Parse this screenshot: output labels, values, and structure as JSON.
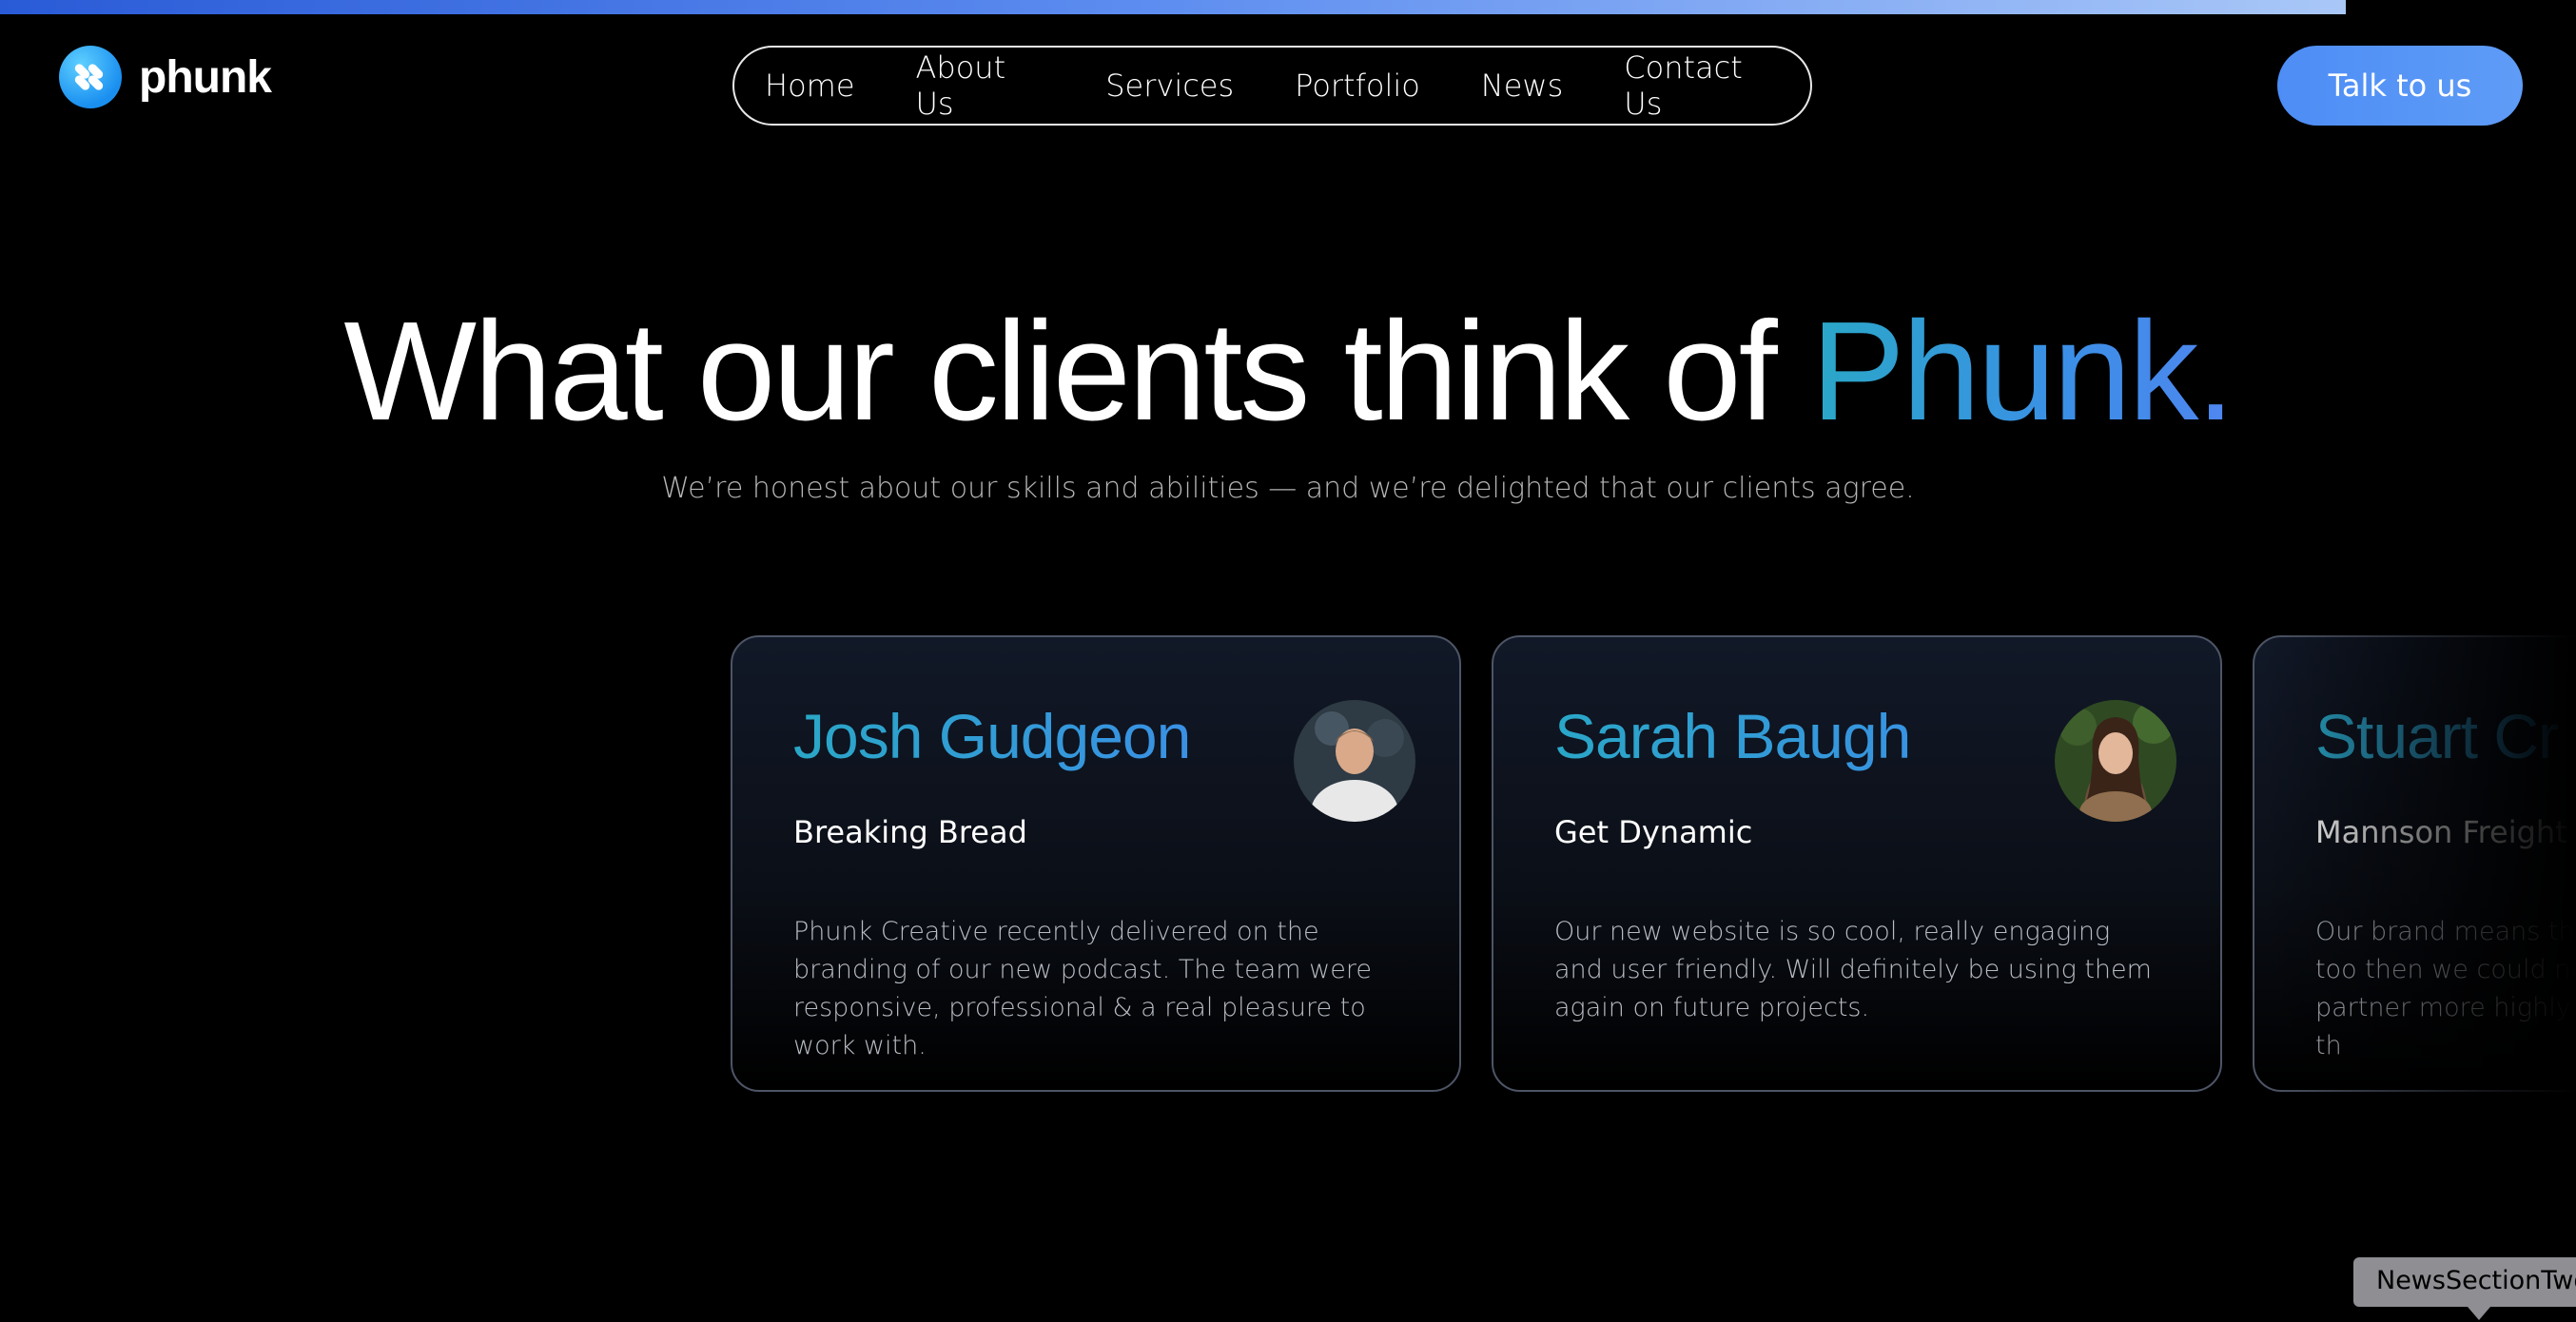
{
  "brand": {
    "name": "phunk",
    "icon": "phunk-logo-icon"
  },
  "nav": {
    "items": [
      {
        "label": "Home"
      },
      {
        "label": "About Us"
      },
      {
        "label": "Services"
      },
      {
        "label": "Portfolio"
      },
      {
        "label": "News"
      },
      {
        "label": "Contact Us"
      }
    ]
  },
  "cta": {
    "label": "Talk to us"
  },
  "hero": {
    "title_main": "What our clients think of ",
    "title_accent": "Phunk.",
    "subtitle": "We’re honest about our skills and abilities — and we’re delighted that our clients agree."
  },
  "testimonials": [
    {
      "name": "Josh Gudgeon",
      "company": "Breaking Bread",
      "quote": "Phunk Creative recently delivered on the branding of our new podcast. The team were responsive, professional & a real pleasure to work with."
    },
    {
      "name": "Sarah Baugh",
      "company": "Get Dynamic",
      "quote": "Our new website is so cool, really engaging and user friendly. Will definitely be using them again on future projects."
    },
    {
      "name": "Stuart Cr",
      "company": "Mannson Freight",
      "quote": "Our brand means the too then we could no partner more highly th"
    }
  ],
  "tooltip": {
    "label": "NewsSectionTwo"
  },
  "colors": {
    "accent_start": "#2aa7c7",
    "accent_end": "#4f86f0",
    "cta": "#5f9cf7",
    "background": "#000000"
  }
}
